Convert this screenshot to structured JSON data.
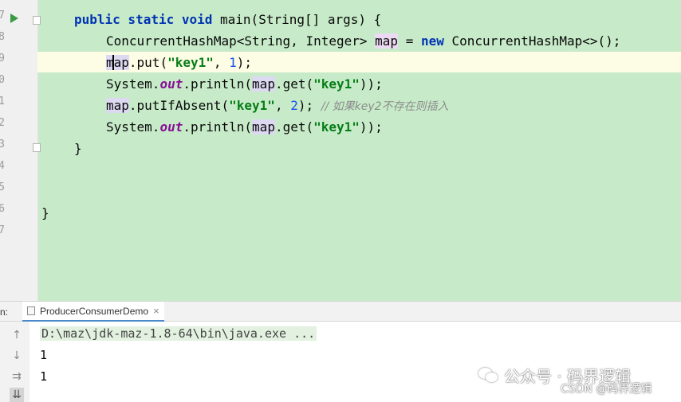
{
  "editor": {
    "line_numbers": [
      "7",
      "8",
      "9",
      "0",
      "1",
      "2",
      "3",
      "4",
      "5",
      "6",
      "7"
    ],
    "code": [
      [
        {
          "t": "public static void",
          "c": "kw"
        },
        {
          "t": " main(String[] args) {",
          "c": ""
        }
      ],
      [
        {
          "t": "ConcurrentHashMap<String, Integer> ",
          "c": ""
        },
        {
          "t": "map",
          "c": "hl2"
        },
        {
          "t": " = ",
          "c": ""
        },
        {
          "t": "new",
          "c": "kw"
        },
        {
          "t": " ConcurrentHashMap<>();",
          "c": ""
        }
      ],
      [
        {
          "t": "map",
          "c": "hl"
        },
        {
          "t": ".put(",
          "c": ""
        },
        {
          "t": "\"key1\"",
          "c": "str"
        },
        {
          "t": ", ",
          "c": ""
        },
        {
          "t": "1",
          "c": "num"
        },
        {
          "t": ");",
          "c": ""
        }
      ],
      [
        {
          "t": "System.",
          "c": ""
        },
        {
          "t": "out",
          "c": "it"
        },
        {
          "t": ".println(",
          "c": ""
        },
        {
          "t": "map",
          "c": "hl"
        },
        {
          "t": ".get(",
          "c": ""
        },
        {
          "t": "\"key1\"",
          "c": "str"
        },
        {
          "t": "));",
          "c": ""
        }
      ],
      [
        {
          "t": "map",
          "c": "hl"
        },
        {
          "t": ".putIfAbsent(",
          "c": ""
        },
        {
          "t": "\"key1\"",
          "c": "str"
        },
        {
          "t": ", ",
          "c": ""
        },
        {
          "t": "2",
          "c": "num"
        },
        {
          "t": "); ",
          "c": ""
        },
        {
          "t": "// 如果key2不存在则插入",
          "c": "cmt"
        }
      ],
      [
        {
          "t": "System.",
          "c": ""
        },
        {
          "t": "out",
          "c": "it"
        },
        {
          "t": ".println(",
          "c": ""
        },
        {
          "t": "map",
          "c": "hl"
        },
        {
          "t": ".get(",
          "c": ""
        },
        {
          "t": "\"key1\"",
          "c": "str"
        },
        {
          "t": "));",
          "c": ""
        }
      ],
      [
        {
          "t": "}",
          "c": ""
        }
      ],
      [
        {
          "t": "}",
          "c": ""
        }
      ]
    ]
  },
  "run_panel": {
    "label": "n:",
    "tab_title": "ProducerConsumerDemo",
    "close_glyph": "×",
    "side_buttons": [
      "↑",
      "↓",
      "⇉",
      "⇊"
    ],
    "output": [
      "D:\\maz\\jdk-maz-1.8-64\\bin\\java.exe ...",
      "1",
      "1"
    ]
  },
  "watermark": {
    "main": "公众号 · 码界逻辑",
    "csdn": "CSDN @码界逻辑"
  }
}
